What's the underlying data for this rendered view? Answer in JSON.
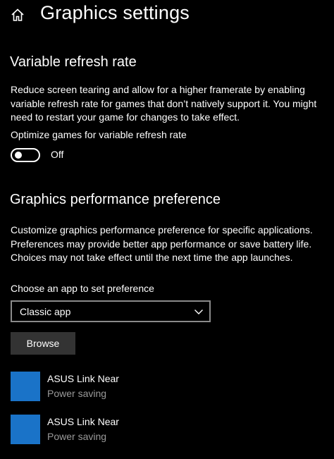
{
  "header": {
    "title": "Graphics settings",
    "home_icon": "home-icon"
  },
  "vrr": {
    "title": "Variable refresh rate",
    "description": "Reduce screen tearing and allow for a higher framerate by enabling variable refresh rate for games that don’t natively support it. You might need to restart your game for changes to take effect.",
    "toggle_label": "Optimize games for variable refresh rate",
    "toggle_state": "Off"
  },
  "gpp": {
    "title": "Graphics performance preference",
    "description": "Customize graphics performance preference for specific applications. Preferences may provide better app performance or save battery life. Choices may not take effect until the next time the app launches.",
    "choose_label": "Choose an app to set preference",
    "selected_app_type": "Classic app",
    "browse_label": "Browse",
    "apps": [
      {
        "name": "ASUS Link Near",
        "preference": "Power saving"
      },
      {
        "name": "ASUS Link Near",
        "preference": "Power saving"
      }
    ]
  },
  "colors": {
    "background": "#000000",
    "text": "#ffffff",
    "secondary_text": "#9a9a9a",
    "button_bg": "#333333",
    "app_tile": "#1a73c8"
  }
}
